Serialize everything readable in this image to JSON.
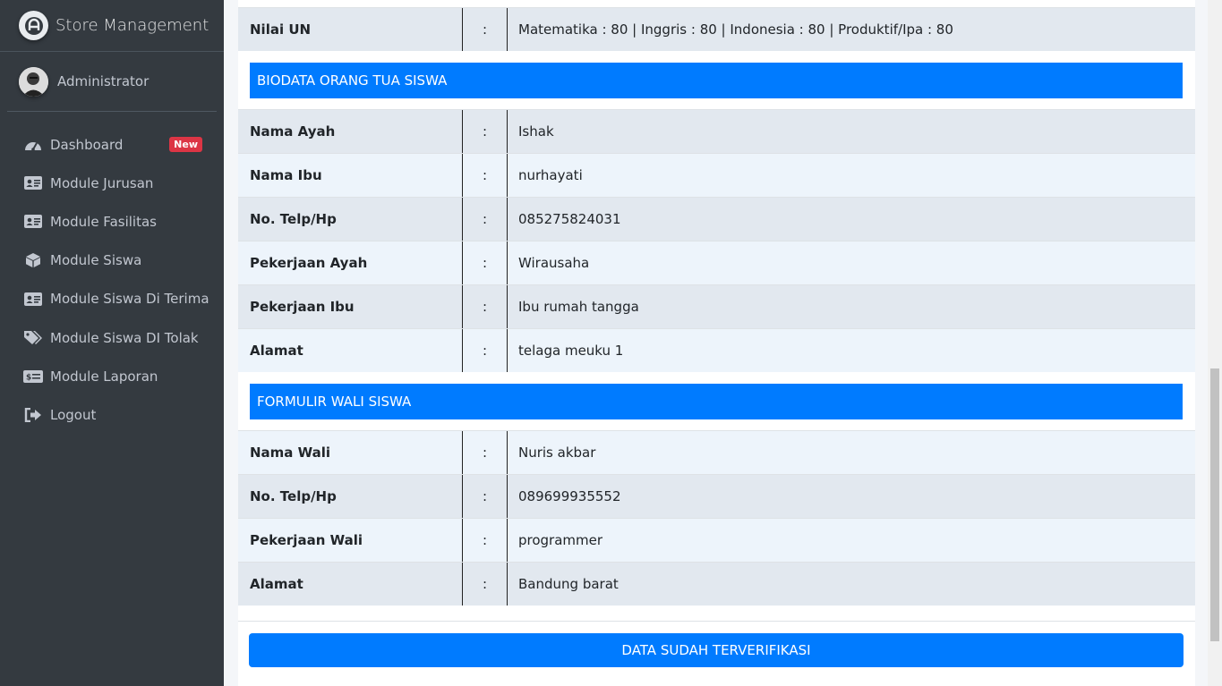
{
  "app": {
    "title": "Store Management"
  },
  "user": {
    "name": "Administrator"
  },
  "sidebar": {
    "items": [
      {
        "label": "Dashboard",
        "icon": "tachometer-icon",
        "badge": "New"
      },
      {
        "label": "Module Jurusan",
        "icon": "id-card-icon"
      },
      {
        "label": "Module Fasilitas",
        "icon": "id-card-icon"
      },
      {
        "label": "Module Siswa",
        "icon": "box-icon"
      },
      {
        "label": "Module Siswa Di Terima",
        "icon": "id-card-icon"
      },
      {
        "label": "Module Siswa DI Tolak",
        "icon": "tags-icon"
      },
      {
        "label": "Module Laporan",
        "icon": "money-bill-icon"
      },
      {
        "label": "Logout",
        "icon": "sign-out-icon"
      }
    ]
  },
  "top_row": {
    "label": "Nilai UN",
    "sep": ":",
    "value": "Matematika : 80 | Inggris : 80 | Indonesia : 80 | Produktif/Ipa : 80"
  },
  "parents": {
    "heading": "BIODATA ORANG TUA SISWA",
    "rows": [
      {
        "label": "Nama Ayah",
        "sep": ":",
        "value": "Ishak"
      },
      {
        "label": "Nama Ibu",
        "sep": ":",
        "value": "nurhayati"
      },
      {
        "label": "No. Telp/Hp",
        "sep": ":",
        "value": "085275824031"
      },
      {
        "label": "Pekerjaan Ayah",
        "sep": ":",
        "value": "Wirausaha"
      },
      {
        "label": "Pekerjaan Ibu",
        "sep": ":",
        "value": "Ibu rumah tangga"
      },
      {
        "label": "Alamat",
        "sep": ":",
        "value": "telaga meuku 1"
      }
    ]
  },
  "guardian": {
    "heading": "FORMULIR WALI SISWA",
    "rows": [
      {
        "label": "Nama Wali",
        "sep": ":",
        "value": "Nuris akbar"
      },
      {
        "label": "No. Telp/Hp",
        "sep": ":",
        "value": "089699935552"
      },
      {
        "label": "Pekerjaan Wali",
        "sep": ":",
        "value": "programmer"
      },
      {
        "label": "Alamat",
        "sep": ":",
        "value": "Bandung barat"
      }
    ]
  },
  "actions": {
    "verify_label": "DATA SUDAH TERVERIFIKASI"
  },
  "colors": {
    "primary": "#007bff",
    "sidebar": "#343a40",
    "badge": "#dc3545"
  }
}
